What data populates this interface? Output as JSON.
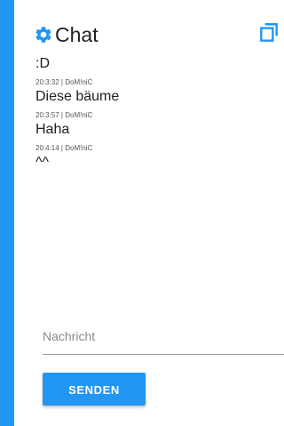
{
  "header": {
    "title": "Chat",
    "icon": "gear-icon",
    "action_icon": "copy-icon"
  },
  "messages": [
    {
      "meta": "",
      "text": ":D"
    },
    {
      "meta": "20:3:32 | DoM!niC",
      "text": "Diese bäume"
    },
    {
      "meta": "20:3:57 | DoM!niC",
      "text": "Haha"
    },
    {
      "meta": "20:4:14 | DoM!niC",
      "text": "^^"
    }
  ],
  "composer": {
    "placeholder": "Nachricht",
    "value": "",
    "send_label": "SENDEN"
  },
  "colors": {
    "accent": "#2196f3",
    "background": "#ffffff"
  }
}
